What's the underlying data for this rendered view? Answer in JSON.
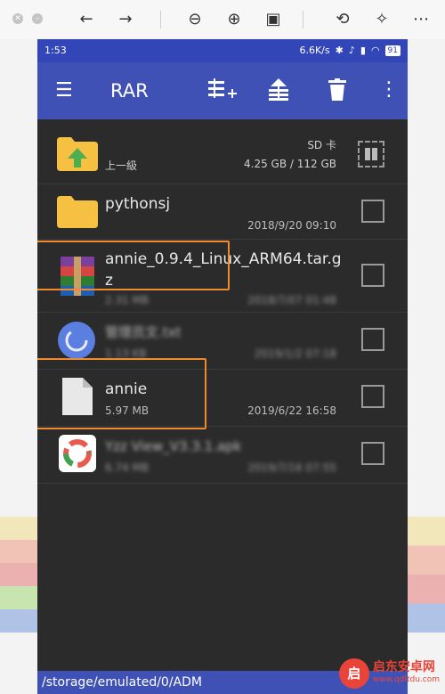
{
  "statusbar": {
    "time": "1:53",
    "speed": "6.6K/s",
    "battery": "91"
  },
  "appbar": {
    "title": "RAR"
  },
  "rows": [
    {
      "name": "上一級",
      "storage": "SD 卡",
      "size": "4.25 GB / 112 GB"
    },
    {
      "name": "pythonsj",
      "date": "2018/9/20 09:10"
    },
    {
      "name_line1": "annie_0.9.4_Linux_ARM64.tar.g",
      "name_line2": "z",
      "size": "2.31 MB",
      "date": "2018/7/07 01:48"
    },
    {
      "name": "管理员文.txt",
      "size": "1.13 KB",
      "date": "2019/1/2 07:18"
    },
    {
      "name": "annie",
      "size": "5.97 MB",
      "date": "2019/6/22 16:58"
    },
    {
      "name": "Yzz View_V3.3.1.apk",
      "size": "6.74 MB",
      "date": "2019/7/16 07:55"
    }
  ],
  "path": "/storage/emulated/0/ADM",
  "watermark": {
    "logo": "启",
    "text": "启东安卓网",
    "url": "www.qdltdu.com"
  },
  "colors": {
    "appbar": "#3f51b5",
    "statusbar": "#3346b8",
    "highlight": "#f08a2e",
    "folder": "#f6c043",
    "list_bg": "#2b2b2b"
  }
}
